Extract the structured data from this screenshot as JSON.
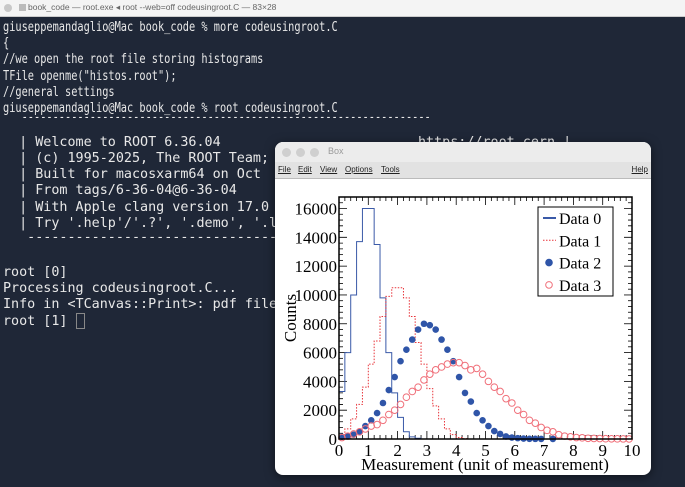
{
  "terminal": {
    "title": "book_code — root.exe ◂ root --web=off codeusingroot.C — 83×28",
    "shell_lines": [
      "giuseppemandaglio@Mac book_code % more codeusingroot.C",
      "{",
      "//we open the root file storing histograms",
      "TFile openme(\"histos.root\");",
      "//general settings",
      "giuseppemandaglio@Mac book_code % root codeusingroot.C"
    ],
    "banner_rule": "   ------------------------------------------------------------------",
    "banner_lines": [
      "  | Welcome to ROOT 6.36.04",
      "  | (c) 1995-2025, The ROOT Team;",
      "  | Built for macosxarm64 on Oct",
      "  | From tags/6-36-04@6-36-04",
      "  | With Apple clang version 17.0",
      "  | Try '.help'/'.?', '.demo', '.l"
    ],
    "banner_url": "https://root.cern |",
    "banner_rule2": "   ------------------------------------------",
    "output_lines": [
      "root [0]",
      "Processing codeusingroot.C...",
      "Info in <TCanvas::Print>: pdf file",
      "root [1] "
    ]
  },
  "canvas_window": {
    "title": "Box",
    "menu": [
      "File",
      "Edit",
      "View",
      "Options",
      "Tools"
    ],
    "help": "Help"
  },
  "chart_data": {
    "type": "histogram",
    "xlabel": "Measurement (unit of measurement)",
    "ylabel": "Counts",
    "xlim": [
      0,
      10
    ],
    "ylim": [
      0,
      16800
    ],
    "xticks": [
      "0",
      "1",
      "2",
      "3",
      "4",
      "5",
      "6",
      "7",
      "8",
      "9",
      "10"
    ],
    "yticks": [
      "0",
      "2000",
      "4000",
      "6000",
      "8000",
      "10000",
      "12000",
      "14000",
      "16000"
    ],
    "bin_width": 0.2,
    "legend_position": "top-right",
    "series": [
      {
        "name": "Data 0",
        "style": "solid-step",
        "color": "#3a5aa8",
        "values": [
          3300,
          6000,
          10000,
          13700,
          16000,
          16000,
          13500,
          9800,
          6000,
          3200,
          1500,
          500,
          150,
          50,
          0,
          0,
          0,
          0,
          0,
          0,
          0,
          0,
          0,
          0,
          0,
          0,
          0,
          0,
          0,
          0,
          0,
          0,
          0,
          0,
          0,
          0,
          0,
          0,
          0,
          0,
          0,
          0,
          0,
          0,
          0,
          0,
          0,
          0,
          0,
          0
        ]
      },
      {
        "name": "Data 1",
        "style": "dotted-step",
        "color": "#e8343a",
        "values": [
          300,
          700,
          1400,
          2400,
          3600,
          5200,
          6800,
          8500,
          9900,
          10500,
          10500,
          9800,
          8500,
          6700,
          5200,
          3500,
          2300,
          1400,
          700,
          300,
          100,
          30,
          0,
          0,
          0,
          0,
          0,
          0,
          0,
          0,
          0,
          0,
          0,
          0,
          0,
          0,
          0,
          0,
          0,
          0,
          0,
          0,
          0,
          0,
          0,
          0,
          0,
          0,
          0,
          0
        ]
      },
      {
        "name": "Data 2",
        "style": "filled-circle",
        "color": "#2f55a8",
        "values": [
          150,
          200,
          300,
          500,
          900,
          1300,
          1800,
          2500,
          3400,
          4300,
          5400,
          6200,
          6900,
          7600,
          8000,
          7900,
          7600,
          6900,
          6200,
          5400,
          4300,
          3200,
          2600,
          1800,
          1300,
          900,
          550,
          350,
          180,
          100,
          60,
          30,
          15,
          10,
          5,
          null,
          5
        ]
      },
      {
        "name": "Data 3",
        "style": "open-circle",
        "color": "#f0707a",
        "values": [
          100,
          200,
          350,
          500,
          700,
          900,
          1000,
          1300,
          1700,
          2000,
          2400,
          2900,
          3300,
          3600,
          4100,
          4500,
          4800,
          5000,
          5200,
          5300,
          5300,
          5100,
          4800,
          4900,
          4500,
          4000,
          3600,
          3300,
          2800,
          2500,
          2000,
          1700,
          1300,
          1100,
          800,
          600,
          500,
          300,
          200,
          150,
          100,
          80,
          50,
          40,
          30,
          20,
          15,
          10,
          8,
          5
        ]
      }
    ]
  }
}
